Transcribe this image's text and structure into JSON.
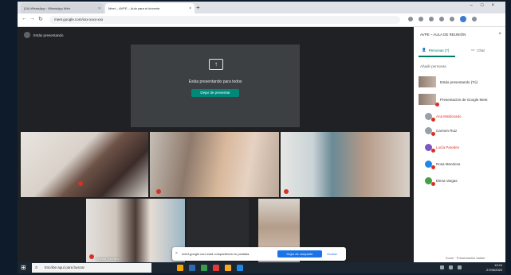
{
  "browser": {
    "tabs": [
      {
        "label": "(24) WhatsApp · WhatsApp Web"
      },
      {
        "label": "Meet – AVPE – Aula para el docente"
      }
    ],
    "new_tab": "+",
    "address": "meet.google.com/xxx-xxxx-xxx"
  },
  "meet": {
    "presenter_label": "Estás presentando",
    "presenting_text": "Estás presentando para todos",
    "stop_presenting": "Dejar de presentar",
    "tiles": [
      {
        "name": ""
      },
      {
        "name": ""
      },
      {
        "name": ""
      },
      {
        "name": "Virginia Paredes"
      },
      {
        "name": ""
      },
      {
        "name": ""
      }
    ],
    "notification": {
      "message": "meet.google.com está compartiendo tu pantalla.",
      "stop": "Dejar de compartir",
      "hide": "Ocultar"
    }
  },
  "panel": {
    "title": "AVPE – AULA DE REUNIÓN",
    "tabs": [
      {
        "label": "Personas (7)"
      },
      {
        "label": "Chat"
      }
    ],
    "add_people": "Añadir personas",
    "participants": [
      {
        "name": "Estás presentando (Tú)",
        "color": "#8d7b6e",
        "kind": "thumb",
        "red": false
      },
      {
        "name": "Presentación de Google Meet",
        "color": "#8d7b6e",
        "kind": "thumb",
        "red": false
      },
      {
        "name": "Ana Maldonado",
        "color": "#9aa0a6",
        "kind": "dot",
        "red": true
      },
      {
        "name": "Carmen Ruiz",
        "color": "#9aa0a6",
        "kind": "dot",
        "red": false
      },
      {
        "name": "Lucía Paredes",
        "color": "#7e57c2",
        "kind": "dot",
        "red": true
      },
      {
        "name": "Rosa Mendoza",
        "color": "#1e88e5",
        "kind": "dot",
        "red": false
      },
      {
        "name": "Elena Vargas",
        "color": "#43a047",
        "kind": "dot",
        "red": false
      }
    ],
    "caption": "Zoom · Presentación visible"
  },
  "taskbar": {
    "search_placeholder": "Escribe aquí para buscar",
    "time": "13:24",
    "date": "27/05/2020",
    "app_colors": [
      "#f0a500",
      "#2b6cb0",
      "#3a9b4f",
      "#e53935",
      "#f9a825",
      "#1e88e5"
    ]
  }
}
